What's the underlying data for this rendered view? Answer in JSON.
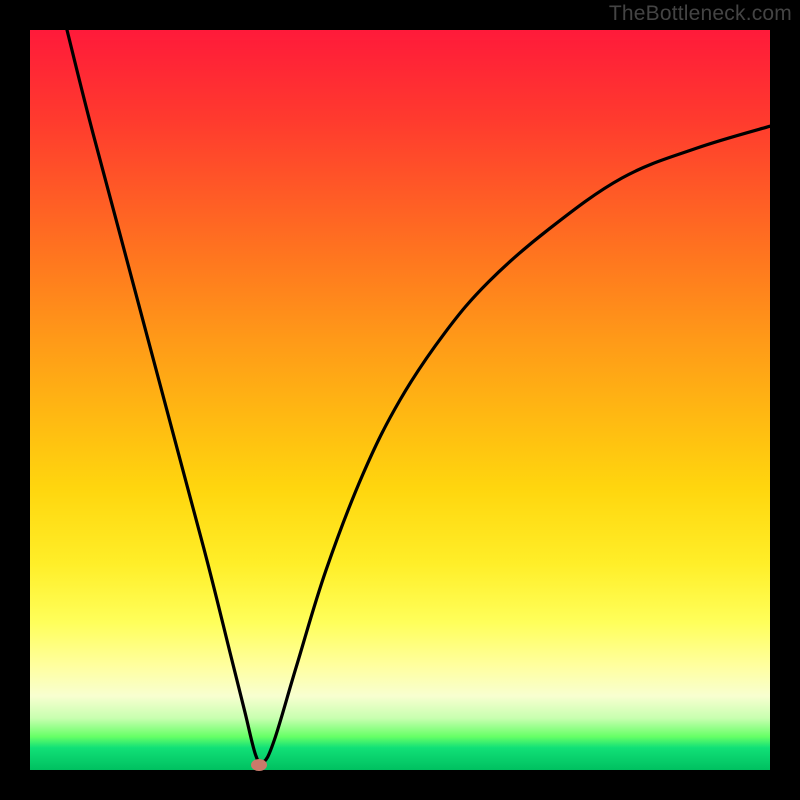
{
  "attribution": "TheBottleneck.com",
  "chart_data": {
    "type": "line",
    "title": "",
    "xlabel": "",
    "ylabel": "",
    "x_range": [
      0,
      100
    ],
    "y_range": [
      0,
      100
    ],
    "grid": false,
    "legend": false,
    "series": [
      {
        "name": "bottleneck-curve",
        "color": "#000000",
        "x": [
          5,
          8,
          12,
          16,
          20,
          24,
          27,
          29,
          30.5,
          31.5,
          33,
          36,
          40,
          45,
          50,
          56,
          62,
          70,
          80,
          90,
          100
        ],
        "y": [
          100,
          88,
          73,
          58,
          43,
          28,
          16,
          8,
          2,
          1,
          4,
          14,
          27,
          40,
          50,
          59,
          66,
          73,
          80,
          84,
          87
        ]
      }
    ],
    "marker": {
      "x": 31.0,
      "y": 0.7,
      "color": "#c97a6a"
    },
    "background_gradient": {
      "top": "#ff1a3a",
      "upper_mid": "#ff9a18",
      "mid": "#ffee28",
      "lower_mid": "#ffffa0",
      "near_bottom": "#66ff66",
      "bottom": "#00c060"
    }
  }
}
